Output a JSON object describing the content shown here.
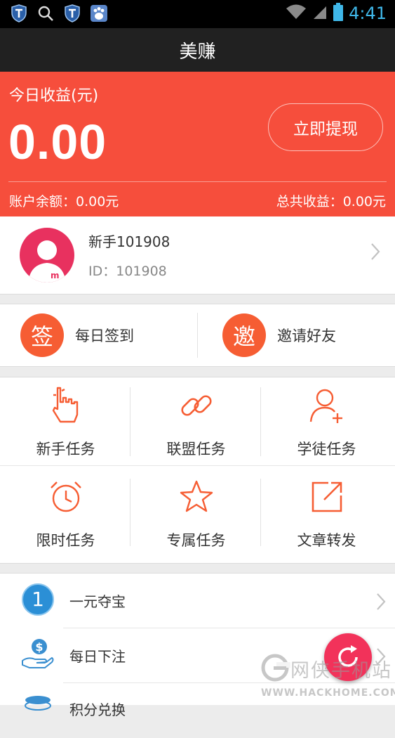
{
  "status_bar": {
    "time": "4:41",
    "icons": [
      "shield-icon",
      "search-icon",
      "shield-icon",
      "baidu-paw-icon",
      "wifi-icon",
      "signal-icon",
      "battery-icon"
    ]
  },
  "app_title": "美赚",
  "earnings": {
    "today_label": "今日收益(元)",
    "today_value": "0.00",
    "withdraw_label": "立即提现",
    "balance_text": "账户余额：0.00元",
    "total_text": "总共收益：0.00元"
  },
  "profile": {
    "name": "新手101908",
    "id_text": "ID：101908"
  },
  "quick_actions": [
    {
      "icon_char": "签",
      "label": "每日签到"
    },
    {
      "icon_char": "邀",
      "label": "邀请好友"
    }
  ],
  "tasks": [
    {
      "icon": "pointer-hand-icon",
      "label": "新手任务"
    },
    {
      "icon": "link-icon",
      "label": "联盟任务"
    },
    {
      "icon": "add-user-icon",
      "label": "学徒任务"
    },
    {
      "icon": "alarm-clock-icon",
      "label": "限时任务"
    },
    {
      "icon": "star-icon",
      "label": "专属任务"
    },
    {
      "icon": "share-arrow-icon",
      "label": "文章转发"
    }
  ],
  "list": [
    {
      "icon": "number-one-icon",
      "label": "一元夺宝"
    },
    {
      "icon": "money-hand-icon",
      "label": "每日下注"
    },
    {
      "icon": "coins-icon",
      "label": "积分兑换"
    }
  ],
  "watermark": {
    "text": "网侠手机站",
    "url": "WWW.HACKHOME.COM"
  },
  "colors": {
    "accent": "#f64e3c",
    "icon_orange": "#f65d33",
    "title_bar": "#212121",
    "avatar_pink": "#e8315f",
    "fab": "#f2325a"
  }
}
